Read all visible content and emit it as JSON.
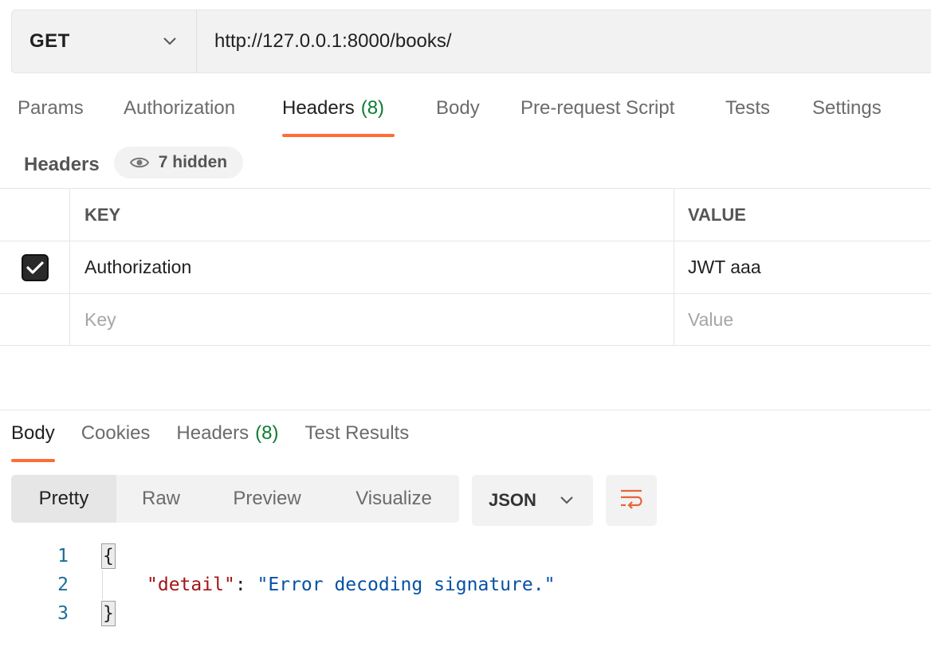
{
  "request": {
    "method": "GET",
    "url": "http://127.0.0.1:8000/books/"
  },
  "request_tabs": [
    {
      "label": "Params"
    },
    {
      "label": "Authorization"
    },
    {
      "label": "Headers",
      "count": "(8)",
      "active": true
    },
    {
      "label": "Body"
    },
    {
      "label": "Pre-request Script"
    },
    {
      "label": "Tests"
    },
    {
      "label": "Settings"
    }
  ],
  "headers_section": {
    "title": "Headers",
    "hidden_label": "7 hidden",
    "columns": {
      "key": "KEY",
      "value": "VALUE"
    },
    "rows": [
      {
        "checked": true,
        "key": "Authorization",
        "value": "JWT aaa"
      }
    ],
    "placeholder": {
      "key": "Key",
      "value": "Value"
    }
  },
  "response_tabs": [
    {
      "label": "Body",
      "active": true
    },
    {
      "label": "Cookies"
    },
    {
      "label": "Headers",
      "count": "(8)"
    },
    {
      "label": "Test Results"
    }
  ],
  "view_modes": [
    "Pretty",
    "Raw",
    "Preview",
    "Visualize"
  ],
  "active_view": "Pretty",
  "format": "JSON",
  "code": {
    "lines": [
      "1",
      "2",
      "3"
    ],
    "open_brace": "{",
    "close_brace": "}",
    "key": "detail",
    "value": "Error decoding signature."
  },
  "colors": {
    "accent": "#ff6c37",
    "count_green": "#0f7b33",
    "json_key": "#a31515",
    "json_string": "#0451a5"
  },
  "icons": [
    "chevron-down-icon",
    "eye-icon",
    "checkbox-checked-icon",
    "wrap-lines-icon"
  ]
}
